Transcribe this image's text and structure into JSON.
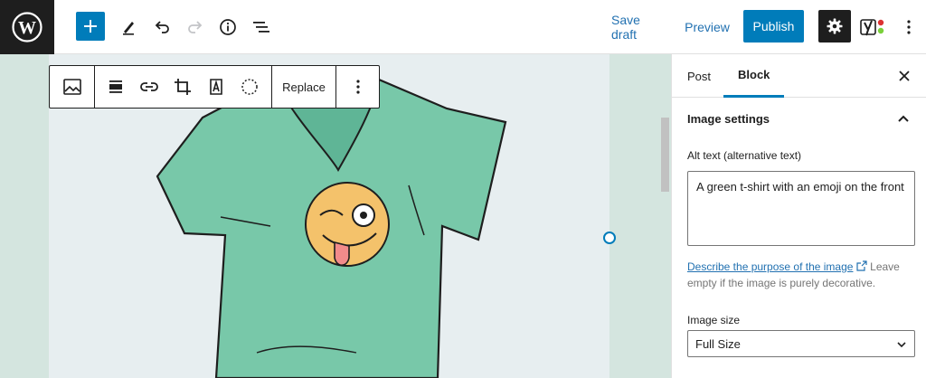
{
  "topbar": {
    "save_draft": "Save draft",
    "preview": "Preview",
    "publish": "Publish"
  },
  "toolbar": {
    "replace": "Replace"
  },
  "sidebar": {
    "tabs": [
      {
        "label": "Post"
      },
      {
        "label": "Block"
      }
    ],
    "panel_title": "Image settings",
    "alt_label": "Alt text (alternative text)",
    "alt_value": "A green t-shirt with an emoji on the front",
    "help_link": "Describe the purpose of the image",
    "help_text": "Leave empty if the image is purely decorative.",
    "size_label": "Image size",
    "size_value": "Full Size"
  },
  "colors": {
    "accent": "#007cba",
    "editor_bg": "#d4e5df",
    "canvas_bg": "#e7eef0",
    "shirt": "#78c8a9"
  }
}
